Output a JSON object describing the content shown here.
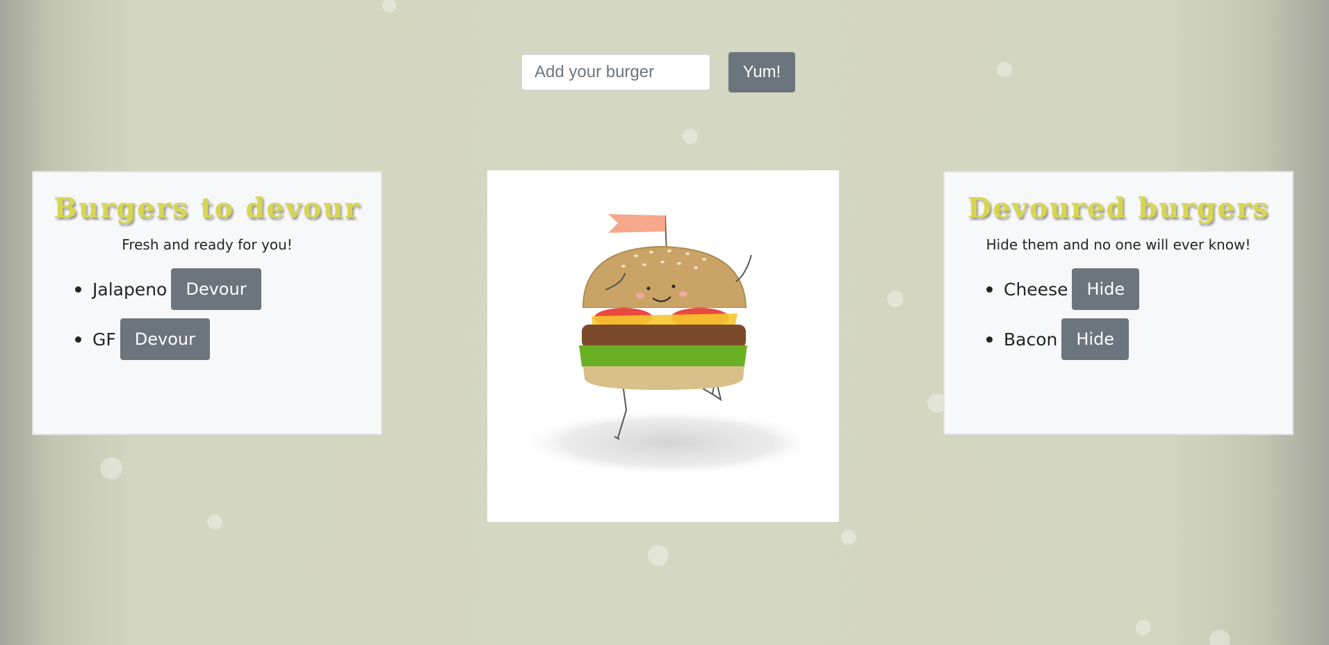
{
  "form": {
    "placeholder": "Add your burger",
    "submit_label": "Yum!"
  },
  "to_devour": {
    "title": "Burgers to devour",
    "subtitle": "Fresh and ready for you!",
    "items": [
      {
        "name": "Jalapeno",
        "action": "Devour"
      },
      {
        "name": "GF",
        "action": "Devour"
      }
    ]
  },
  "devoured": {
    "title": "Devoured burgers",
    "subtitle": "Hide them and no one will ever know!",
    "items": [
      {
        "name": "Cheese",
        "action": "Hide"
      },
      {
        "name": "Bacon",
        "action": "Hide"
      }
    ]
  },
  "colors": {
    "title": "#d8d650",
    "button": "#6c757d",
    "background": "#d4d7c1"
  },
  "image": {
    "icon": "dancing-burger-illustration"
  }
}
